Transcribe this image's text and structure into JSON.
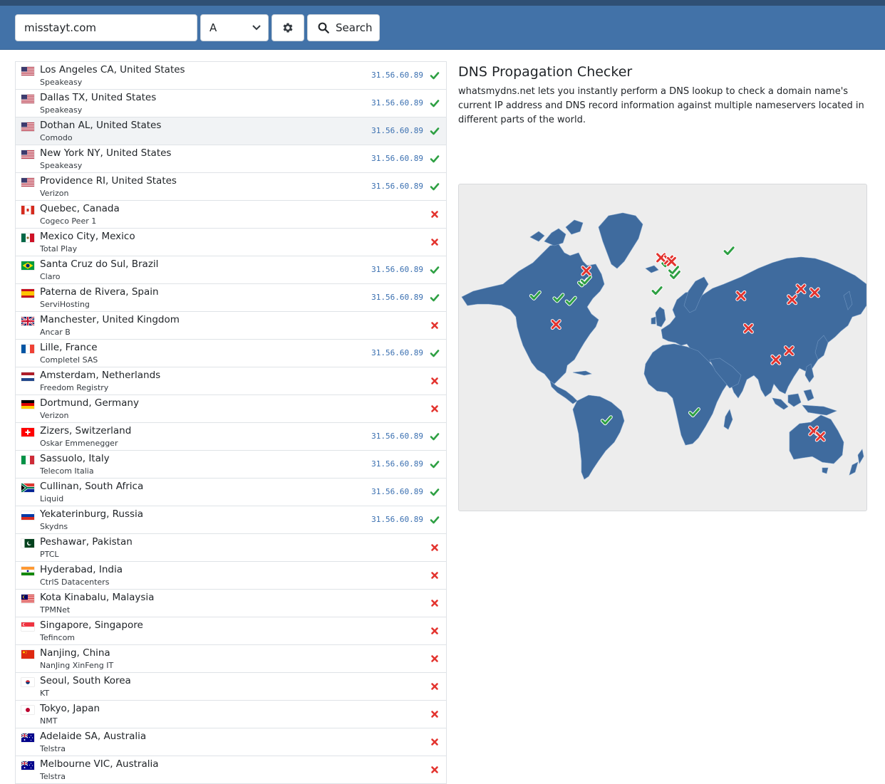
{
  "search": {
    "domain_value": "misstayt.com",
    "record_type": "A",
    "button_label": "Search"
  },
  "info": {
    "title": "DNS Propagation Checker",
    "description": "whatsmydns.net lets you instantly perform a DNS lookup to check a domain name's current IP address and DNS record information against multiple nameservers located in different parts of the world."
  },
  "colors": {
    "header": "#4272a8",
    "ok": "#2ea043",
    "fail": "#e3342f",
    "map_land": "#3f6b9e",
    "ip": "#3a6fb0"
  },
  "results": [
    {
      "location": "Los Angeles CA, United States",
      "provider": "Speakeasy",
      "ip": "31.56.60.89",
      "status": "ok",
      "flag": "us"
    },
    {
      "location": "Dallas TX, United States",
      "provider": "Speakeasy",
      "ip": "31.56.60.89",
      "status": "ok",
      "flag": "us"
    },
    {
      "location": "Dothan AL, United States",
      "provider": "Comodo",
      "ip": "31.56.60.89",
      "status": "ok",
      "flag": "us"
    },
    {
      "location": "New York NY, United States",
      "provider": "Speakeasy",
      "ip": "31.56.60.89",
      "status": "ok",
      "flag": "us"
    },
    {
      "location": "Providence RI, United States",
      "provider": "Verizon",
      "ip": "31.56.60.89",
      "status": "ok",
      "flag": "us"
    },
    {
      "location": "Quebec, Canada",
      "provider": "Cogeco Peer 1",
      "ip": "",
      "status": "fail",
      "flag": "ca"
    },
    {
      "location": "Mexico City, Mexico",
      "provider": "Total Play",
      "ip": "",
      "status": "fail",
      "flag": "mx"
    },
    {
      "location": "Santa Cruz do Sul, Brazil",
      "provider": "Claro",
      "ip": "31.56.60.89",
      "status": "ok",
      "flag": "br"
    },
    {
      "location": "Paterna de Rivera, Spain",
      "provider": "ServiHosting",
      "ip": "31.56.60.89",
      "status": "ok",
      "flag": "es"
    },
    {
      "location": "Manchester, United Kingdom",
      "provider": "Ancar B",
      "ip": "",
      "status": "fail",
      "flag": "gb"
    },
    {
      "location": "Lille, France",
      "provider": "Completel SAS",
      "ip": "31.56.60.89",
      "status": "ok",
      "flag": "fr"
    },
    {
      "location": "Amsterdam, Netherlands",
      "provider": "Freedom Registry",
      "ip": "",
      "status": "fail",
      "flag": "nl"
    },
    {
      "location": "Dortmund, Germany",
      "provider": "Verizon",
      "ip": "",
      "status": "fail",
      "flag": "de"
    },
    {
      "location": "Zizers, Switzerland",
      "provider": "Oskar Emmenegger",
      "ip": "31.56.60.89",
      "status": "ok",
      "flag": "ch"
    },
    {
      "location": "Sassuolo, Italy",
      "provider": "Telecom Italia",
      "ip": "31.56.60.89",
      "status": "ok",
      "flag": "it"
    },
    {
      "location": "Cullinan, South Africa",
      "provider": "Liquid",
      "ip": "31.56.60.89",
      "status": "ok",
      "flag": "za"
    },
    {
      "location": "Yekaterinburg, Russia",
      "provider": "Skydns",
      "ip": "31.56.60.89",
      "status": "ok",
      "flag": "ru"
    },
    {
      "location": "Peshawar, Pakistan",
      "provider": "PTCL",
      "ip": "",
      "status": "fail",
      "flag": "pk"
    },
    {
      "location": "Hyderabad, India",
      "provider": "CtrlS Datacenters",
      "ip": "",
      "status": "fail",
      "flag": "in"
    },
    {
      "location": "Kota Kinabalu, Malaysia",
      "provider": "TPMNet",
      "ip": "",
      "status": "fail",
      "flag": "my"
    },
    {
      "location": "Singapore, Singapore",
      "provider": "Tefincom",
      "ip": "",
      "status": "fail",
      "flag": "sg"
    },
    {
      "location": "Nanjing, China",
      "provider": "NanJing XinFeng IT",
      "ip": "",
      "status": "fail",
      "flag": "cn"
    },
    {
      "location": "Seoul, South Korea",
      "provider": "KT",
      "ip": "",
      "status": "fail",
      "flag": "kr"
    },
    {
      "location": "Tokyo, Japan",
      "provider": "NMT",
      "ip": "",
      "status": "fail",
      "flag": "jp"
    },
    {
      "location": "Adelaide SA, Australia",
      "provider": "Telstra",
      "ip": "",
      "status": "fail",
      "flag": "au"
    },
    {
      "location": "Melbourne VIC, Australia",
      "provider": "Telstra",
      "ip": "",
      "status": "fail",
      "flag": "au"
    }
  ],
  "map_markers": [
    {
      "name": "Los Angeles",
      "lat": 34.05,
      "lon": -118.24,
      "status": "ok"
    },
    {
      "name": "Dallas",
      "lat": 32.78,
      "lon": -96.8,
      "status": "ok"
    },
    {
      "name": "Dothan",
      "lat": 31.22,
      "lon": -85.39,
      "status": "ok"
    },
    {
      "name": "New York",
      "lat": 40.71,
      "lon": -74.0,
      "status": "ok"
    },
    {
      "name": "Providence",
      "lat": 41.82,
      "lon": -71.41,
      "status": "ok"
    },
    {
      "name": "Quebec",
      "lat": 46.81,
      "lon": -71.21,
      "status": "fail"
    },
    {
      "name": "Mexico City",
      "lat": 19.43,
      "lon": -99.13,
      "status": "fail"
    },
    {
      "name": "Santa Cruz do Sul",
      "lat": -29.72,
      "lon": -52.43,
      "status": "ok"
    },
    {
      "name": "Paterna de Rivera",
      "lat": 36.52,
      "lon": -5.87,
      "status": "ok"
    },
    {
      "name": "Manchester",
      "lat": 53.48,
      "lon": -2.24,
      "status": "fail"
    },
    {
      "name": "Lille",
      "lat": 50.63,
      "lon": 3.06,
      "status": "ok"
    },
    {
      "name": "Amsterdam",
      "lat": 52.37,
      "lon": 4.9,
      "status": "fail"
    },
    {
      "name": "Dortmund",
      "lat": 51.51,
      "lon": 7.47,
      "status": "fail"
    },
    {
      "name": "Zizers",
      "lat": 46.93,
      "lon": 9.56,
      "status": "ok"
    },
    {
      "name": "Sassuolo",
      "lat": 44.55,
      "lon": 10.78,
      "status": "ok"
    },
    {
      "name": "Cullinan",
      "lat": -25.68,
      "lon": 28.52,
      "status": "ok"
    },
    {
      "name": "Yekaterinburg",
      "lat": 56.84,
      "lon": 60.6,
      "status": "ok"
    },
    {
      "name": "Peshawar",
      "lat": 34.02,
      "lon": 71.58,
      "status": "fail"
    },
    {
      "name": "Hyderabad",
      "lat": 17.39,
      "lon": 78.49,
      "status": "fail"
    },
    {
      "name": "Kota Kinabalu",
      "lat": 5.98,
      "lon": 116.07,
      "status": "fail"
    },
    {
      "name": "Singapore",
      "lat": 1.35,
      "lon": 103.82,
      "status": "fail"
    },
    {
      "name": "Nanjing",
      "lat": 32.06,
      "lon": 118.8,
      "status": "fail"
    },
    {
      "name": "Seoul",
      "lat": 37.57,
      "lon": 126.98,
      "status": "fail"
    },
    {
      "name": "Tokyo",
      "lat": 35.68,
      "lon": 139.69,
      "status": "fail"
    },
    {
      "name": "Adelaide",
      "lat": -34.93,
      "lon": 138.6,
      "status": "fail"
    },
    {
      "name": "Melbourne",
      "lat": -37.81,
      "lon": 144.96,
      "status": "fail"
    }
  ]
}
